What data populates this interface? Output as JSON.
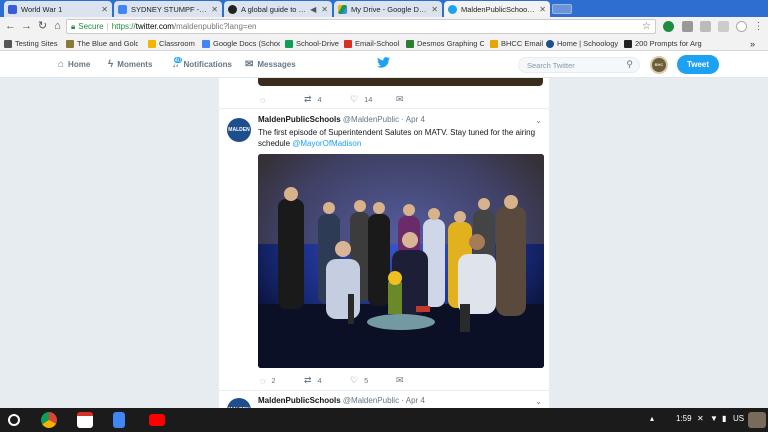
{
  "browser": {
    "tabs": [
      {
        "title": "World War 1",
        "color": "#3b5bdb"
      },
      {
        "title": "SYDNEY STUMPF - WWI",
        "color": "#4285f4"
      },
      {
        "title": "A global guide to the",
        "color": "#222222"
      },
      {
        "title": "My Drive - Google Drive",
        "color": "#f4b400"
      },
      {
        "title": "MaldenPublicSchools (@",
        "color": "#1da1f2"
      }
    ],
    "address": {
      "secure_label": "Secure",
      "protocol": "https://",
      "host": "twitter.com",
      "path": "/maldenpublic?lang=en"
    },
    "bookmarks": [
      "Testing Sites",
      "The Blue and Gold | T",
      "Classroom",
      "Google Docs (Schoo",
      "School-Drive",
      "Email-School",
      "Desmos Graphing Ca",
      "BHCC Email",
      "Home | Schoology",
      "200 Prompts for Arg"
    ]
  },
  "twitter": {
    "nav": {
      "home": "Home",
      "moments": "Moments",
      "notifications": "Notifications",
      "messages": "Messages",
      "notif_count": "40"
    },
    "search_placeholder": "Search Twitter",
    "tweet_button": "Tweet",
    "avatar_text": "BHC",
    "brand_color": "#1da1f2"
  },
  "timeline": {
    "prev_tweet": {
      "retweets": "4",
      "likes": "14"
    },
    "tweet": {
      "name": "MaldenPublicSchools",
      "handle": "@MaldenPublic",
      "date": "Apr 4",
      "text": "The first episode of Superintendent Salutes on MATV.  Stay tuned for the airing schedule ",
      "mention": "@MayorOfMadison",
      "avatar_text": "MALDEN",
      "replies": "2",
      "retweets": "4",
      "likes": "5"
    },
    "next_tweet": {
      "name": "MaldenPublicSchools",
      "handle": "@MaldenPublic",
      "date": "Apr 4"
    }
  },
  "taskbar": {
    "time": "1:59",
    "locale": "US"
  }
}
